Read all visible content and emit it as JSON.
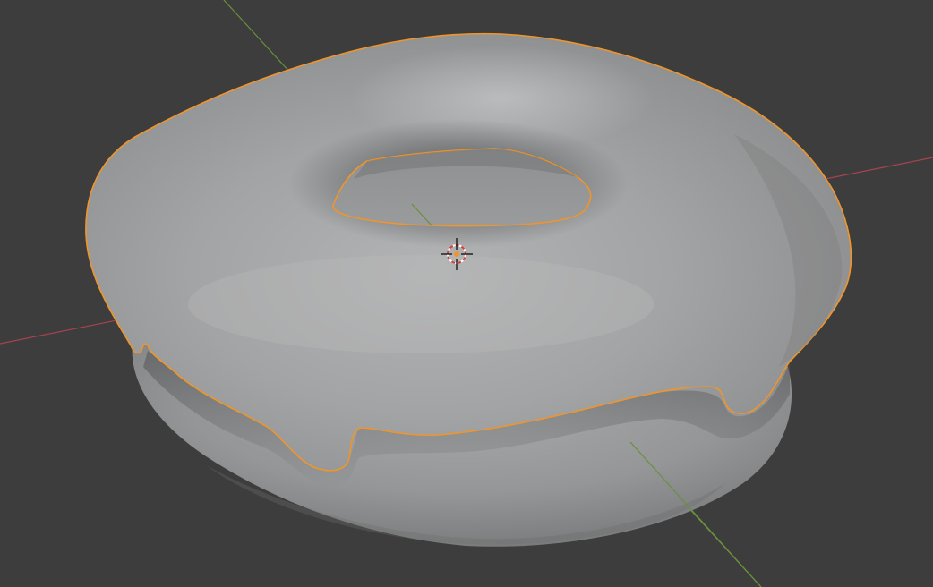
{
  "viewport": {
    "background_color": "#3d3d3d",
    "axis_x_color": "#a8444f",
    "axis_y_color": "#6a8f3c",
    "selection_outline_color": "#f0952a",
    "object_base_color": "#9c9d9e",
    "cursor_icon": "3d-cursor-icon",
    "objects": [
      {
        "name_icon": "donut-base-mesh",
        "selected": false
      },
      {
        "name_icon": "donut-icing-mesh",
        "selected": true
      }
    ]
  }
}
